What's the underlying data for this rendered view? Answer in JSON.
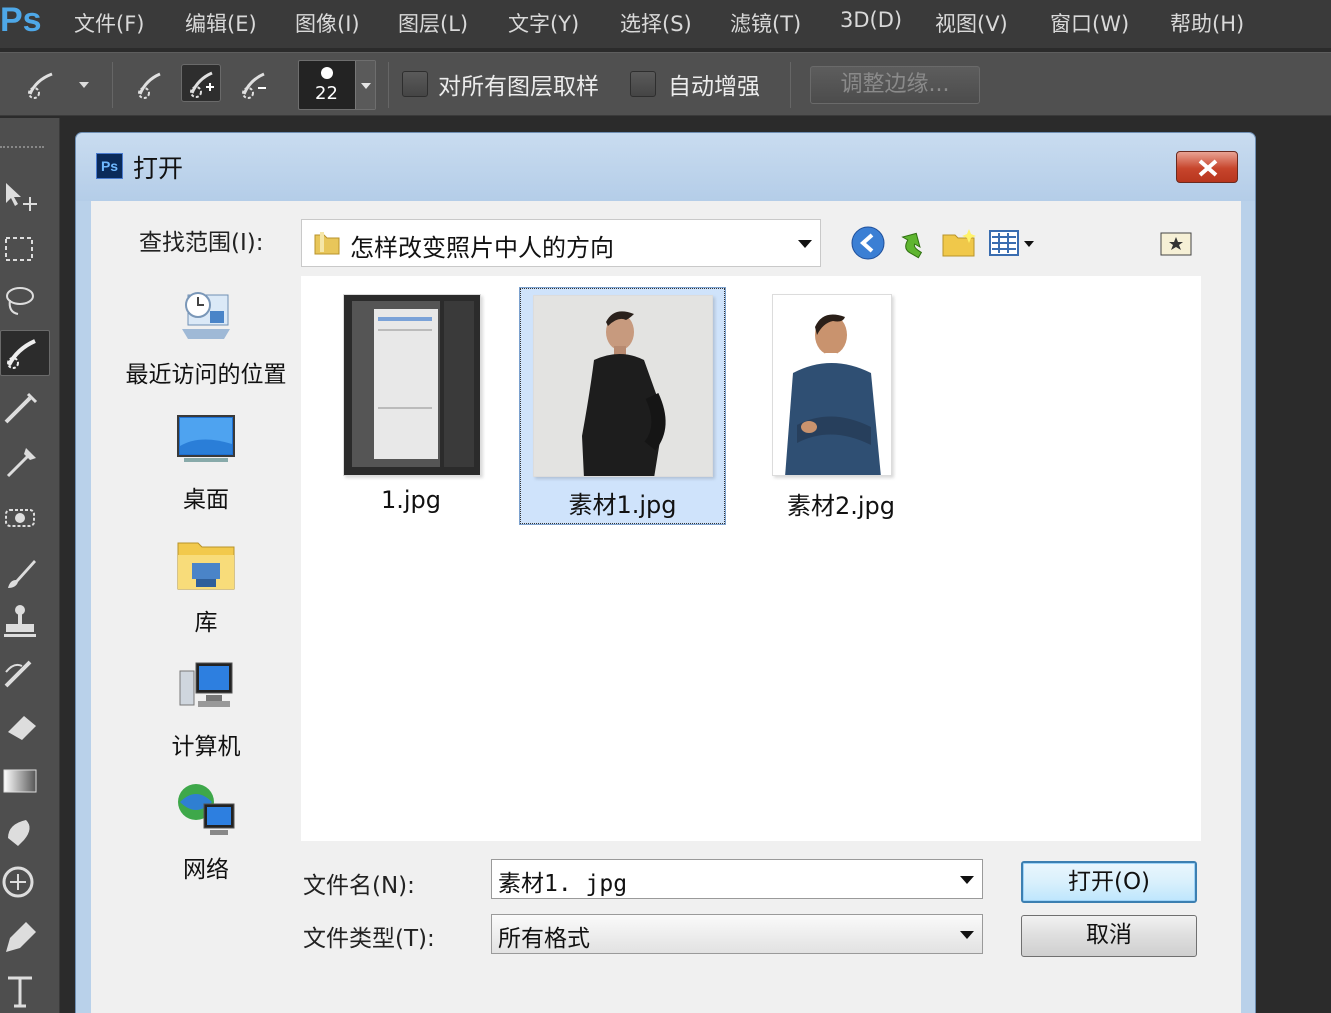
{
  "app": {
    "logo": "Ps",
    "menu": [
      "文件(F)",
      "编辑(E)",
      "图像(I)",
      "图层(L)",
      "文字(Y)",
      "选择(S)",
      "滤镜(T)",
      "3D(D)",
      "视图(V)",
      "窗口(W)",
      "帮助(H)"
    ]
  },
  "options_bar": {
    "brush_size": "22",
    "sample_all_layers_label": "对所有图层取样",
    "auto_enhance_label": "自动增强",
    "refine_edge_label": "调整边缘..."
  },
  "tools": [
    "move-tool-icon",
    "marquee-tool-icon",
    "lasso-tool-icon",
    "quick-selection-tool-icon",
    "crop-tool-icon",
    "eyedropper-tool-icon",
    "healing-brush-tool-icon",
    "brush-tool-icon",
    "clone-stamp-tool-icon",
    "history-brush-tool-icon",
    "eraser-tool-icon",
    "gradient-tool-icon",
    "blur-tool-icon",
    "dodge-tool-icon",
    "pen-tool-icon",
    "type-tool-icon"
  ],
  "dialog": {
    "title": "打开",
    "look_in_label": "查找范围(I):",
    "look_in_value": "怎样改变照片中人的方向",
    "places": [
      {
        "label": "最近访问的位置",
        "icon": "recent-places-icon"
      },
      {
        "label": "桌面",
        "icon": "desktop-icon"
      },
      {
        "label": "库",
        "icon": "libraries-icon"
      },
      {
        "label": "计算机",
        "icon": "computer-icon"
      },
      {
        "label": "网络",
        "icon": "network-icon"
      }
    ],
    "files": [
      {
        "name": "1.jpg",
        "selected": false
      },
      {
        "name": "素材1.jpg",
        "selected": true
      },
      {
        "name": "素材2.jpg",
        "selected": false
      }
    ],
    "file_name_label": "文件名(N):",
    "file_name_value": "素材1. jpg",
    "file_type_label": "文件类型(T):",
    "file_type_value": "所有格式",
    "open_button": "打开(O)",
    "cancel_button": "取消"
  }
}
